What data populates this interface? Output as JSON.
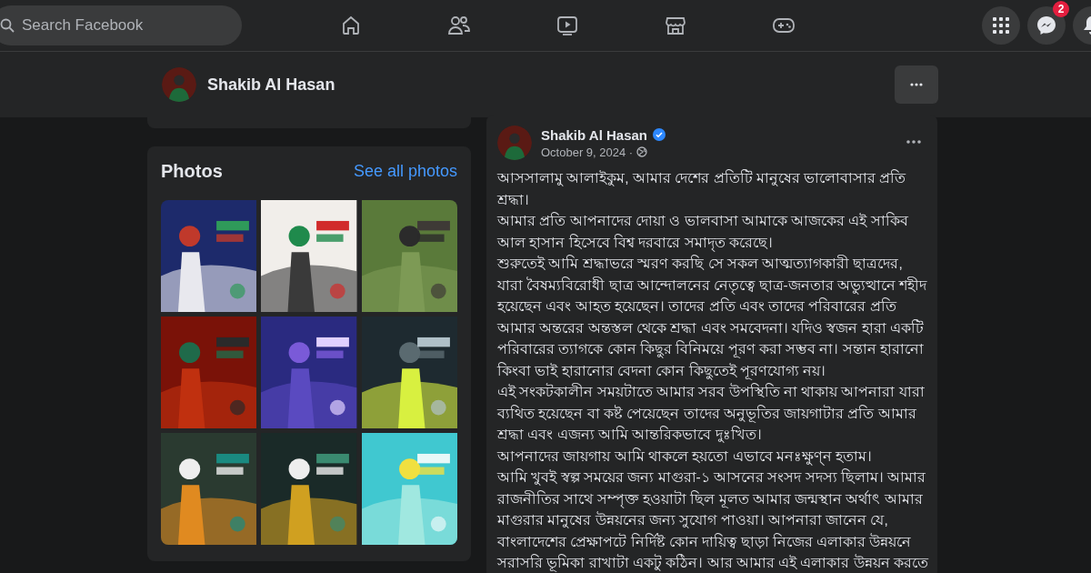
{
  "topbar": {
    "search": {
      "placeholder": "Search Facebook"
    },
    "nav": [
      {
        "kind": "home",
        "selected": false
      },
      {
        "kind": "friends",
        "selected": false
      },
      {
        "kind": "video",
        "selected": false
      },
      {
        "kind": "store",
        "selected": false
      },
      {
        "kind": "gaming",
        "selected": false
      }
    ],
    "actions": [
      {
        "kind": "menu"
      },
      {
        "kind": "messenger",
        "badge": "2"
      },
      {
        "kind": "bell"
      }
    ]
  },
  "profile_header": {
    "name": "Shakib Al Hasan"
  },
  "photos": {
    "title": "Photos",
    "link": "See all photos"
  },
  "post": {
    "author": "Shakib Al Hasan",
    "verified": true,
    "date": "October 9, 2024 ·",
    "paragraphs": [
      "আসসালামু আলাইকুম, আমার দেশের প্রতিটি মানুষের ভালোবাসার প্রতি শ্রদ্ধা।",
      "আমার প্রতি আপনাদের দোয়া ও ভালবাসা আমাকে আজকের এই সাকিব আল হাসান হিসেবে বিশ্ব দরবারে সমাদৃত করেছে।",
      "শুরুতেই আমি শ্রদ্ধাভরে স্মরণ করছি সে সকল আত্মত্যাগকারী ছাত্রদের, যারা বৈষম্যবিরোধী ছাত্র আন্দোলনের নেতৃত্বে ছাত্র-জনতার অভ্যুত্থানে শহীদ হয়েছেন এবং আহত হয়েছেন। তাদের প্রতি এবং তাদের পরিবারের প্রতি আমার অন্তরের অন্তস্তল থেকে শ্রদ্ধা এবং সমবেদনা। যদিও স্বজন হারা একটি পরিবারের ত্যাগকে কোন কিছুর বিনিময়ে পূরণ করা সম্ভব না। সন্তান হারানো কিংবা ভাই হারানোর বেদনা কোন কিছুতেই পূরণযোগ্য নয়।",
      "এই সংকটকালীন সময়টাতে আমার সরব উপস্থিতি না থাকায় আপনারা যারা ব্যথিত হয়েছেন বা কষ্ট পেয়েছেন তাদের অনুভূতির জায়গাটার প্রতি আমার শ্রদ্ধা এবং এজন্য আমি আন্তরিকভাবে দুঃখিত।",
      "আপনাদের জায়গায় আমি থাকলে হয়তো এভাবে মনঃক্ষুণ্ন হতাম।",
      "আমি খুবই স্বল্প সময়ের জন্য মাগুরা-১ আসনের সংসদ সদস্য ছিলাম। আমার রাজনীতির সাথে সম্পৃক্ত হওয়াটা ছিল মূলত আমার জন্মস্থান অর্থাৎ আমার মাগুরার মানুষের উন্নয়নের জন্য সুযোগ পাওয়া। আপনারা জানেন যে, বাংলাদেশের প্রেক্ষাপটে নির্দিষ্ট কোন দায়িত্ব ছাড়া নিজের এলাকার উন্নয়নে সরাসরি ভূমিকা রাখাটা একটু কঠিন। আর আমার এই এলাকার উন্নয়ন করতে"
    ]
  }
}
